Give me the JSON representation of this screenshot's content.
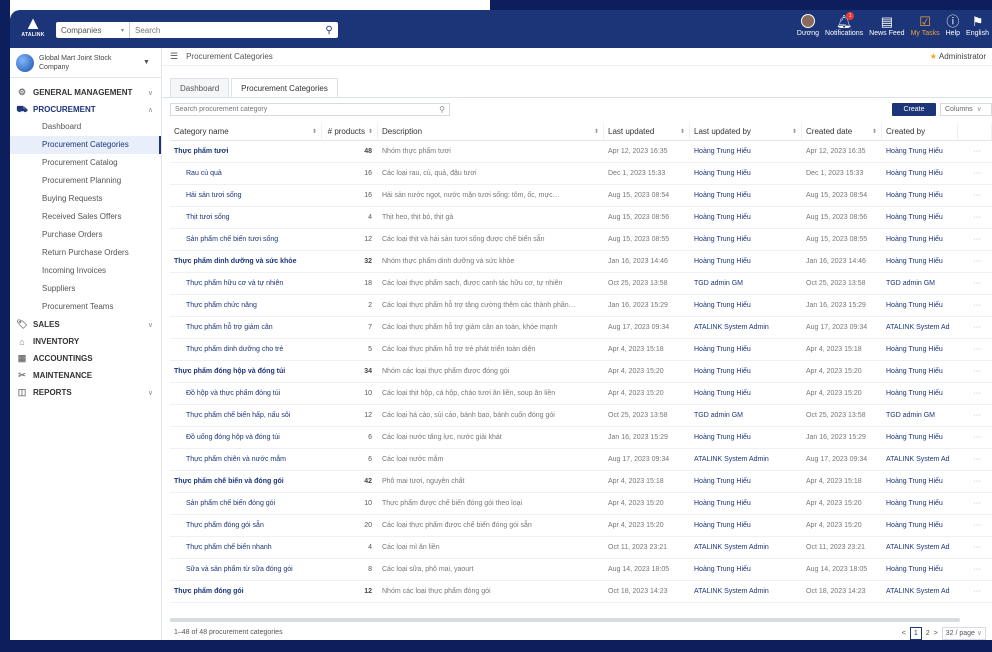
{
  "topbar": {
    "logo_text": "ATALINK",
    "search_scope": "Companies",
    "search_placeholder": "Search",
    "nav": [
      {
        "label": "Dương",
        "icon": "avatar-icon"
      },
      {
        "label": "Notifications",
        "icon": "bell-icon",
        "badge": "1"
      },
      {
        "label": "News Feed",
        "icon": "newspaper-icon"
      },
      {
        "label": "My Tasks",
        "icon": "tasks-icon"
      },
      {
        "label": "Help",
        "icon": "help-icon"
      },
      {
        "label": "English",
        "icon": "flag-icon"
      }
    ]
  },
  "sidebar": {
    "company": "Global Mart Joint Stock Company",
    "groups": [
      {
        "label": "GENERAL MANAGEMENT",
        "icon": "gear-icon"
      },
      {
        "label": "PROCUREMENT",
        "icon": "cart-icon"
      },
      {
        "label": "SALES",
        "icon": "tag-icon"
      },
      {
        "label": "INVENTORY",
        "icon": "warehouse-icon"
      },
      {
        "label": "ACCOUNTINGS",
        "icon": "calculator-icon"
      },
      {
        "label": "MAINTENANCE",
        "icon": "wrench-icon"
      },
      {
        "label": "REPORTS",
        "icon": "report-icon"
      }
    ],
    "procurement_items": [
      "Dashboard",
      "Procurement Categories",
      "Procurement Catalog",
      "Procurement Planning",
      "Buying Requests",
      "Received Sales Offers",
      "Purchase Orders",
      "Return Purchase Orders",
      "Incoming Invoices",
      "Suppliers",
      "Procurement Teams"
    ]
  },
  "breadcrumb": {
    "title": "Procurement Categories",
    "role": "Administrator"
  },
  "tabs": [
    "Dashboard",
    "Procurement Categories"
  ],
  "toolbar": {
    "search_placeholder": "Search procurement category",
    "create": "Create",
    "columns": "Columns"
  },
  "table": {
    "headers": [
      "Category name",
      "# products",
      "Description",
      "Last updated",
      "Last updated by",
      "Created date",
      "Created by"
    ],
    "rows": [
      {
        "level": "parent",
        "name": "Thực phẩm tươi",
        "products": "48",
        "desc": "Nhóm thực phẩm tươi",
        "updated": "Apr 12, 2023 16:35",
        "updated_by": "Hoàng Trung Hiếu",
        "created": "Apr 12, 2023 16:35",
        "created_by": "Hoàng Trung Hiếu"
      },
      {
        "level": "child",
        "name": "Rau củ quả",
        "products": "16",
        "desc": "Các loại rau, củ, quả, đậu tươi",
        "updated": "Dec 1, 2023 15:33",
        "updated_by": "Hoàng Trung Hiếu",
        "created": "Dec 1, 2023 15:33",
        "created_by": "Hoàng Trung Hiếu"
      },
      {
        "level": "child",
        "name": "Hải sản tươi sống",
        "products": "16",
        "desc": "Hải sản nước ngọt, nước mặn tươi sống: tôm, ốc, mực…",
        "updated": "Aug 15, 2023 08:54",
        "updated_by": "Hoàng Trung Hiếu",
        "created": "Aug 15, 2023 08:54",
        "created_by": "Hoàng Trung Hiếu"
      },
      {
        "level": "child",
        "name": "Thịt tươi sống",
        "products": "4",
        "desc": "Thịt heo, thịt bò, thịt gà",
        "updated": "Aug 15, 2023 08:56",
        "updated_by": "Hoàng Trung Hiếu",
        "created": "Aug 15, 2023 08:56",
        "created_by": "Hoàng Trung Hiếu"
      },
      {
        "level": "child",
        "name": "Sản phẩm chế biến tươi sống",
        "products": "12",
        "desc": "Các loại thịt và hải sản tươi sống được chế biến sẵn",
        "updated": "Aug 15, 2023 08:55",
        "updated_by": "Hoàng Trung Hiếu",
        "created": "Aug 15, 2023 08:55",
        "created_by": "Hoàng Trung Hiếu"
      },
      {
        "level": "parent",
        "name": "Thực phẩm dinh dưỡng và sức khỏe",
        "products": "32",
        "desc": "Nhóm thực phẩm dinh dưỡng và sức khỏe",
        "updated": "Jan 16, 2023 14:46",
        "updated_by": "Hoàng Trung Hiếu",
        "created": "Jan 16, 2023 14:46",
        "created_by": "Hoàng Trung Hiếu"
      },
      {
        "level": "child",
        "name": "Thực phẩm hữu cơ và tự nhiên",
        "products": "18",
        "desc": "Các loại thực phẩm sạch, được canh tác hữu cơ, tự nhiên",
        "updated": "Oct 25, 2023 13:58",
        "updated_by": "TGD admin GM",
        "created": "Oct 25, 2023 13:58",
        "created_by": "TGD admin GM"
      },
      {
        "level": "child",
        "name": "Thực phẩm chức năng",
        "products": "2",
        "desc": "Các loại thực phẩm hỗ trợ tăng cường thêm các thành phần…",
        "updated": "Jan 16, 2023 15:29",
        "updated_by": "Hoàng Trung Hiếu",
        "created": "Jan 16, 2023 15:29",
        "created_by": "Hoàng Trung Hiếu"
      },
      {
        "level": "child",
        "name": "Thực phẩm hỗ trợ giảm cân",
        "products": "7",
        "desc": "Các loại thực phẩm hỗ trợ giảm cân an toàn, khỏe mạnh",
        "updated": "Aug 17, 2023 09:34",
        "updated_by": "ATALINK System Admin",
        "created": "Aug 17, 2023 09:34",
        "created_by": "ATALINK System Ad"
      },
      {
        "level": "child",
        "name": "Thực phẩm dinh dưỡng cho trẻ",
        "products": "5",
        "desc": "Các loại thực phẩm hỗ trợ trẻ phát triển toàn diện",
        "updated": "Apr 4, 2023 15:18",
        "updated_by": "Hoàng Trung Hiếu",
        "created": "Apr 4, 2023 15:18",
        "created_by": "Hoàng Trung Hiếu"
      },
      {
        "level": "parent",
        "name": "Thực phẩm đóng hộp và đóng túi",
        "products": "34",
        "desc": "Nhóm các loại thực phẩm được đóng gói",
        "updated": "Apr 4, 2023 15:20",
        "updated_by": "Hoàng Trung Hiếu",
        "created": "Apr 4, 2023 15:20",
        "created_by": "Hoàng Trung Hiếu"
      },
      {
        "level": "child",
        "name": "Đồ hộp và thực phẩm đóng túi",
        "products": "10",
        "desc": "Các loại thịt hộp, cá hộp, cháo tươi ăn liền, soup ăn liền",
        "updated": "Apr 4, 2023 15:20",
        "updated_by": "Hoàng Trung Hiếu",
        "created": "Apr 4, 2023 15:20",
        "created_by": "Hoàng Trung Hiếu"
      },
      {
        "level": "child",
        "name": "Thực phẩm chế biến hấp, nấu sôi",
        "products": "12",
        "desc": "Các loại há cảo, sủi cảo, bánh bao, bánh cuốn đóng gói",
        "updated": "Oct 25, 2023 13:58",
        "updated_by": "TGD admin GM",
        "created": "Oct 25, 2023 13:58",
        "created_by": "TGD admin GM"
      },
      {
        "level": "child",
        "name": "Đồ uống đóng hộp và đóng túi",
        "products": "6",
        "desc": "Các loại nước tăng lực, nước giải khát",
        "updated": "Jan 16, 2023 15:29",
        "updated_by": "Hoàng Trung Hiếu",
        "created": "Jan 16, 2023 15:29",
        "created_by": "Hoàng Trung Hiếu"
      },
      {
        "level": "child",
        "name": "Thực phẩm chiên và nước mắm",
        "products": "6",
        "desc": "Các loại nước mắm",
        "updated": "Aug 17, 2023 09:34",
        "updated_by": "ATALINK System Admin",
        "created": "Aug 17, 2023 09:34",
        "created_by": "ATALINK System Ad"
      },
      {
        "level": "parent",
        "name": "Thực phẩm chế biến và đóng gói",
        "products": "42",
        "desc": "Phô mai tươi, nguyên chất",
        "updated": "Apr 4, 2023 15:18",
        "updated_by": "Hoàng Trung Hiếu",
        "created": "Apr 4, 2023 15:18",
        "created_by": "Hoàng Trung Hiếu"
      },
      {
        "level": "child",
        "name": "Sản phẩm chế biến đóng gói",
        "products": "10",
        "desc": "Thực phẩm được chế biến đóng gói theo loại",
        "updated": "Apr 4, 2023 15:20",
        "updated_by": "Hoàng Trung Hiếu",
        "created": "Apr 4, 2023 15:20",
        "created_by": "Hoàng Trung Hiếu"
      },
      {
        "level": "child",
        "name": "Thực phẩm đóng gói sẵn",
        "products": "20",
        "desc": "Các loại thực phẩm được chế biến đóng gói sẵn",
        "updated": "Apr 4, 2023 15:20",
        "updated_by": "Hoàng Trung Hiếu",
        "created": "Apr 4, 2023 15:20",
        "created_by": "Hoàng Trung Hiếu"
      },
      {
        "level": "child",
        "name": "Thực phẩm chế biến nhanh",
        "products": "4",
        "desc": "Các loại mì ăn liền",
        "updated": "Oct 11, 2023 23:21",
        "updated_by": "ATALINK System Admin",
        "created": "Oct 11, 2023 23:21",
        "created_by": "ATALINK System Ad"
      },
      {
        "level": "child",
        "name": "Sữa và sản phẩm từ sữa đóng gói",
        "products": "8",
        "desc": "Các loại sữa, phô mai, yaourt",
        "updated": "Aug 14, 2023 18:05",
        "updated_by": "Hoàng Trung Hiếu",
        "created": "Aug 14, 2023 18:05",
        "created_by": "Hoàng Trung Hiếu"
      },
      {
        "level": "parent",
        "name": "Thực phẩm đóng gói",
        "products": "12",
        "desc": "Nhóm các loại thực phẩm đóng gói",
        "updated": "Oct 18, 2023 14:23",
        "updated_by": "ATALINK System Admin",
        "created": "Oct 18, 2023 14:23",
        "created_by": "ATALINK System Ad"
      }
    ],
    "more": "···"
  },
  "footer": {
    "summary": "1–48 of 48 procurement categories",
    "prev": "<",
    "page_current": "1",
    "page_next": "2",
    "next": ">",
    "page_size": "32 / page"
  }
}
